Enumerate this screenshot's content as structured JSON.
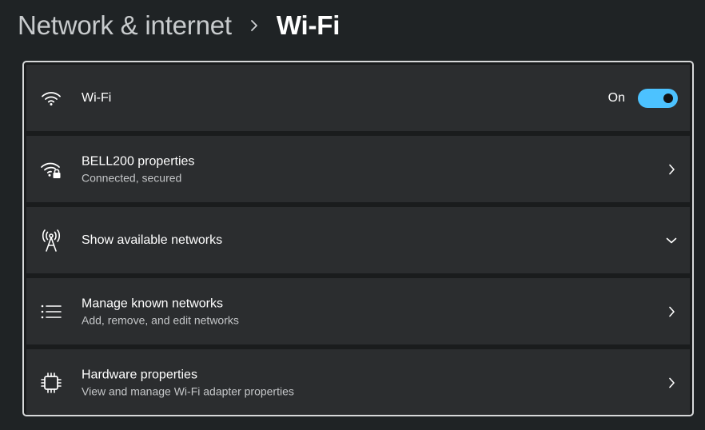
{
  "breadcrumb": {
    "parent": "Network & internet",
    "current": "Wi-Fi"
  },
  "wifi_row": {
    "label": "Wi-Fi",
    "toggle_state": "On",
    "toggle_on": true,
    "icon": "wifi-icon"
  },
  "rows": [
    {
      "title": "BELL200 properties",
      "subtitle": "Connected, secured",
      "icon": "wifi-lock-icon",
      "action": "chevron-right"
    },
    {
      "title": "Show available networks",
      "icon": "antenna-icon",
      "action": "chevron-down"
    },
    {
      "title": "Manage known networks",
      "subtitle": "Add, remove, and edit networks",
      "icon": "list-icon",
      "action": "chevron-right"
    },
    {
      "title": "Hardware properties",
      "subtitle": "View and manage Wi-Fi adapter properties",
      "icon": "chip-icon",
      "action": "chevron-right"
    }
  ],
  "colors": {
    "accent": "#4cc2ff",
    "background": "#1f2325",
    "card": "#2b2d2f",
    "panel_border": "#d7d9da"
  }
}
